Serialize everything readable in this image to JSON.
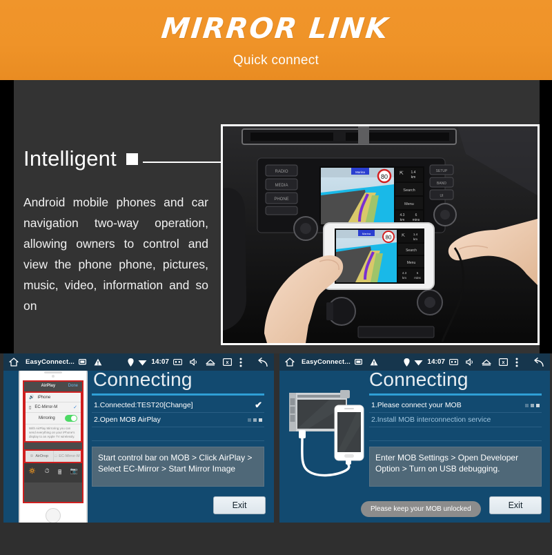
{
  "header": {
    "title": "MIRROR LINK",
    "subtitle": "Quick connect",
    "bg_color": "#ef9328"
  },
  "feature": {
    "heading": "Intelligent",
    "body": "Android mobile phones and car navigation two-way operation, allowing owners to control and view the phone phone, pictures, music, video, information and so on",
    "bg_color": "#333333"
  },
  "photo": {
    "alt": "Car dashboard head unit mirroring navigation onto a handheld phone",
    "nav_labels": {
      "speed_limit": "80",
      "distance_next": "1.4 km",
      "search": "Search",
      "menu": "Menu",
      "trip_distance": "4.3 km",
      "trip_time": "6 mins"
    },
    "head_unit_buttons": [
      "RADIO",
      "MEDIA",
      "PHONE",
      "SETUP",
      "BAND",
      "UI"
    ]
  },
  "panels": [
    {
      "id": "airplay-panel",
      "statusbar": {
        "home_icon": "home-icon",
        "app_name": "EasyConnect...",
        "cast_icon": "cast-icon",
        "warning_icon": "warning-icon",
        "location_icon": "location-pin-icon",
        "wifi_icon": "wifi-icon",
        "time": "14:07",
        "screenshot_icon": "screenshot-icon",
        "volume_icon": "volume-icon",
        "eject_icon": "eject-icon",
        "close-box_icon": "close-box-icon",
        "overflow_icon": "overflow-menu-icon",
        "back_icon": "back-arrow-icon"
      },
      "title": "Connecting",
      "steps": [
        {
          "label": "1.Connected:TEST20[Change]",
          "state": "done",
          "indicator": "check"
        },
        {
          "label": "2.Open MOB AirPlay",
          "state": "active",
          "indicator": "dots"
        }
      ],
      "instruction": "Start control bar on MOB > Click AirPlay > Select EC-Mirror > Start Mirror Image",
      "exit_label": "Exit",
      "phone_mock": {
        "panel_title": "AirPlay",
        "done_label": "Done",
        "rows": [
          {
            "label": "iPhone",
            "icon": "speaker-icon"
          },
          {
            "label": "EC-Mirror-M",
            "icon": "monitor-icon",
            "selected": true
          },
          {
            "label": "Mirroring",
            "icon": "",
            "toggle": "on"
          }
        ],
        "note": "With AirPlay Mirroring you can send everything on your iPhone's display to an Apple TV wirelessly.",
        "drop_rows": [
          "AirDrop",
          "EC-Mirror-M"
        ],
        "tools": [
          "flashlight-icon",
          "clock-icon",
          "calculator-icon",
          "camera-icon"
        ]
      }
    },
    {
      "id": "usb-panel",
      "statusbar": {
        "home_icon": "home-icon",
        "app_name": "EasyConnect...",
        "cast_icon": "cast-icon",
        "warning_icon": "warning-icon",
        "location_icon": "location-pin-icon",
        "wifi_icon": "wifi-icon",
        "time": "14:07",
        "screenshot_icon": "screenshot-icon",
        "volume_icon": "volume-icon",
        "eject_icon": "eject-icon",
        "close-box_icon": "close-box-icon",
        "overflow_icon": "overflow-menu-icon",
        "back_icon": "back-arrow-icon"
      },
      "title": "Connecting",
      "steps": [
        {
          "label": "1.Please connect your MOB",
          "state": "active",
          "indicator": "dots"
        },
        {
          "label": "2.Install MOB interconnection service",
          "state": "pending",
          "indicator": "none"
        }
      ],
      "instruction": "Enter MOB Settings > Open Developer Option > Turn on USB debugging.",
      "exit_label": "Exit",
      "toast": "Please keep your MOB unlocked",
      "illustration": "car-head-unit-usb-phone"
    }
  ],
  "colors": {
    "panel_bg": "#124a70",
    "statusbar_bg": "#16364d",
    "accent_bar": "#2f9fd6",
    "instruction_bg": "#4f6878",
    "exit_button_bg": "#e6eef3",
    "toast_bg": "#8c8c8c"
  }
}
